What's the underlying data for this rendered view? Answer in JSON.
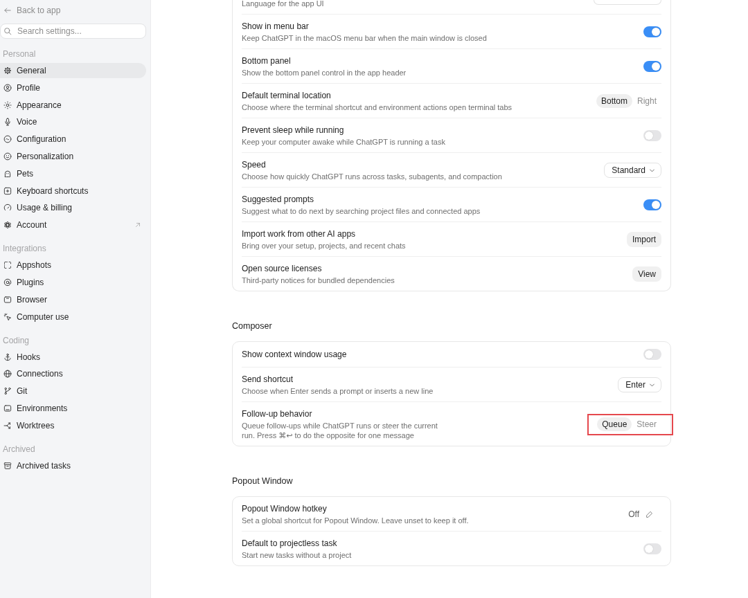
{
  "sidebar": {
    "back_link": "Back to app",
    "search": {
      "placeholder": "Search settings..."
    },
    "sections": [
      {
        "title": "Personal",
        "items": [
          {
            "label": "General",
            "selected": true,
            "external": false
          },
          {
            "label": "Profile",
            "selected": false,
            "external": false
          },
          {
            "label": "Appearance",
            "selected": false,
            "external": false
          },
          {
            "label": "Voice",
            "selected": false,
            "external": false
          },
          {
            "label": "Configuration",
            "selected": false,
            "external": false
          },
          {
            "label": "Personalization",
            "selected": false,
            "external": false
          },
          {
            "label": "Pets",
            "selected": false,
            "external": false
          },
          {
            "label": "Keyboard shortcuts",
            "selected": false,
            "external": false
          },
          {
            "label": "Usage & billing",
            "selected": false,
            "external": false
          },
          {
            "label": "Account",
            "selected": false,
            "external": true
          }
        ]
      },
      {
        "title": "Integrations",
        "items": [
          {
            "label": "Appshots",
            "selected": false,
            "external": false
          },
          {
            "label": "Plugins",
            "selected": false,
            "external": false
          },
          {
            "label": "Browser",
            "selected": false,
            "external": false
          },
          {
            "label": "Computer use",
            "selected": false,
            "external": false
          }
        ]
      },
      {
        "title": "Coding",
        "items": [
          {
            "label": "Hooks",
            "selected": false,
            "external": false
          },
          {
            "label": "Connections",
            "selected": false,
            "external": false
          },
          {
            "label": "Git",
            "selected": false,
            "external": false
          },
          {
            "label": "Environments",
            "selected": false,
            "external": false
          },
          {
            "label": "Worktrees",
            "selected": false,
            "external": false
          }
        ]
      },
      {
        "title": "Archived",
        "items": [
          {
            "label": "Archived tasks",
            "selected": false,
            "external": false
          }
        ]
      }
    ]
  },
  "groups": [
    {
      "rows": [
        {
          "kind": "clipped",
          "description": "Language for the app UI",
          "highlighted": false
        },
        {
          "kind": "toggle",
          "title": "Show in menu bar",
          "description": "Keep ChatGPT in the macOS menu bar when the main window is closed",
          "on": true,
          "highlighted": false
        },
        {
          "kind": "toggle",
          "title": "Bottom panel",
          "description": "Show the bottom panel control in the app header",
          "on": true,
          "highlighted": false
        },
        {
          "kind": "segmented",
          "title": "Default terminal location",
          "description": "Choose where the terminal shortcut and environment actions open terminal tabs",
          "options": [
            {
              "label": "Bottom",
              "selected": true
            },
            {
              "label": "Right",
              "selected": false
            }
          ],
          "highlighted": false
        },
        {
          "kind": "toggle",
          "title": "Prevent sleep while running",
          "description": "Keep your computer awake while ChatGPT is running a task",
          "on": false,
          "highlighted": false
        },
        {
          "kind": "dropdown",
          "title": "Speed",
          "description": "Choose how quickly ChatGPT runs across tasks, subagents, and compaction",
          "value": "Standard",
          "highlighted": false
        },
        {
          "kind": "toggle",
          "title": "Suggested prompts",
          "description": "Suggest what to do next by searching project files and connected apps",
          "on": true,
          "highlighted": false
        },
        {
          "kind": "button",
          "title": "Import work from other AI apps",
          "description": "Bring over your setup, projects, and recent chats",
          "label": "Import",
          "highlighted": false
        },
        {
          "kind": "button",
          "title": "Open source licenses",
          "description": "Third-party notices for bundled dependencies",
          "label": "View",
          "highlighted": false
        }
      ]
    },
    {
      "title": "Composer",
      "rows": [
        {
          "kind": "toggle",
          "title": "Show context window usage",
          "on": false,
          "highlighted": false
        },
        {
          "kind": "dropdown",
          "title": "Send shortcut",
          "description": "Choose when Enter sends a prompt or inserts a new line",
          "value": "Enter",
          "highlighted": false
        },
        {
          "kind": "segmented",
          "title": "Follow-up behavior",
          "description": "Queue follow-ups while ChatGPT runs or steer the current\nrun. Press ⌘↩ to do the opposite for one message",
          "options": [
            {
              "label": "Queue",
              "selected": true
            },
            {
              "label": "Steer",
              "selected": false
            }
          ],
          "highlighted": true
        }
      ]
    },
    {
      "title": "Popout Window",
      "rows": [
        {
          "kind": "hotkey",
          "title": "Popout Window hotkey",
          "description": "Set a global shortcut for Popout Window. Leave unset to keep it off.",
          "value": "Off",
          "highlighted": false
        },
        {
          "kind": "toggle",
          "title": "Default to projectless task",
          "description": "Start new tasks without a project",
          "on": false,
          "highlighted": false
        }
      ]
    }
  ]
}
